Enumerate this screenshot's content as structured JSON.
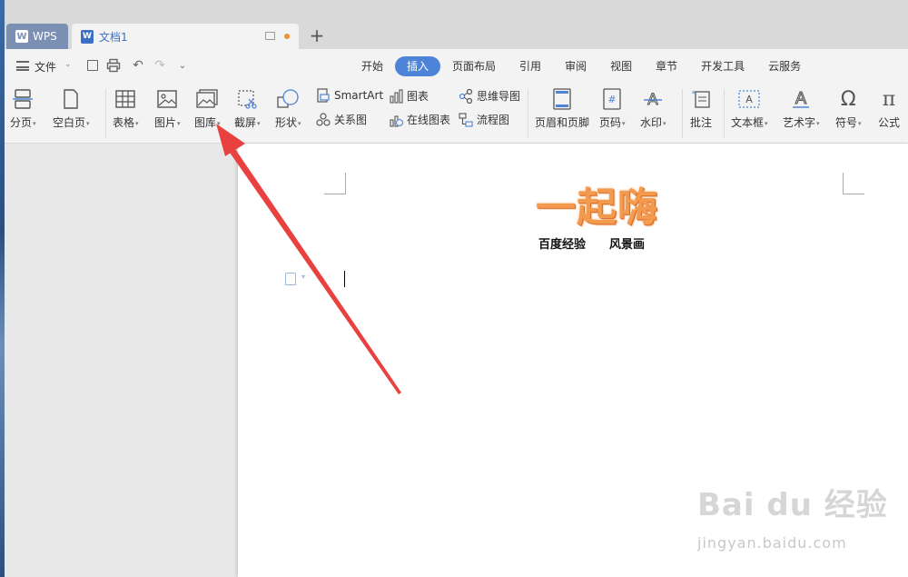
{
  "tabs": {
    "app_tab": "WPS",
    "doc_tab": "文档1",
    "add_tab": "+"
  },
  "menu": {
    "file_label": "文件",
    "ribbon_tabs": [
      {
        "label": "开始",
        "active": false
      },
      {
        "label": "插入",
        "active": true
      },
      {
        "label": "页面布局",
        "active": false
      },
      {
        "label": "引用",
        "active": false
      },
      {
        "label": "审阅",
        "active": false
      },
      {
        "label": "视图",
        "active": false
      },
      {
        "label": "章节",
        "active": false
      },
      {
        "label": "开发工具",
        "active": false
      },
      {
        "label": "云服务",
        "active": false
      }
    ]
  },
  "ribbon": {
    "page_break": "分页",
    "blank_page": "空白页",
    "table": "表格",
    "picture": "图片",
    "gallery": "图库",
    "screenshot": "截屏",
    "shapes": "形状",
    "smartart": "SmartArt",
    "relation": "关系图",
    "chart": "图表",
    "online_chart": "在线图表",
    "mindmap": "思维导图",
    "flowchart": "流程图",
    "header_footer": "页眉和页脚",
    "page_number": "页码",
    "watermark": "水印",
    "comment": "批注",
    "textbox": "文本框",
    "wordart": "艺术字",
    "symbol": "符号",
    "formula": "公式"
  },
  "document": {
    "title": "一起嗨",
    "subtitle_left": "百度经验",
    "subtitle_right": "风景画"
  },
  "watermark": {
    "brand": "Bai du 经验",
    "url": "jingyan.baidu.com"
  },
  "colors": {
    "accent": "#4d84d8",
    "title_orange": "#f39a4d",
    "arrow_red": "#e8413f"
  }
}
